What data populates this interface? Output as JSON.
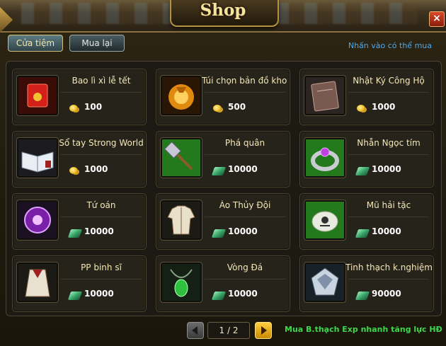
{
  "window": {
    "title": "Shop",
    "close_label": "×"
  },
  "tabs": [
    {
      "label": "Cửa tiệm",
      "active": true
    },
    {
      "label": "Mua lại",
      "active": false
    }
  ],
  "hint": "Nhấn vào có thể mua",
  "items": [
    {
      "name": "Bao lì xì lễ tết",
      "price": "100",
      "currency": "coin-icon",
      "icon": "red-envelope-icon"
    },
    {
      "name": "Túi chọn bản đồ kho báu",
      "price": "500",
      "currency": "coin-icon",
      "icon": "treasure-bag-icon"
    },
    {
      "name": "Nhật Ký Công Hộ",
      "price": "1000",
      "currency": "coin-icon",
      "icon": "journal-book-icon"
    },
    {
      "name": "Sổ tay Strong World",
      "price": "1000",
      "currency": "coin-icon",
      "icon": "open-book-icon"
    },
    {
      "name": "Phá quân",
      "price": "10000",
      "currency": "jade-icon",
      "icon": "hammer-icon"
    },
    {
      "name": "Nhẫn Ngọc tím",
      "price": "10000",
      "currency": "jade-icon",
      "icon": "purple-ring-icon"
    },
    {
      "name": "Tứ oán",
      "price": "10000",
      "currency": "jade-icon",
      "icon": "purple-orb-icon"
    },
    {
      "name": "Áo Thủy Đội",
      "price": "10000",
      "currency": "jade-icon",
      "icon": "navy-coat-icon"
    },
    {
      "name": "Mũ hải tặc",
      "price": "10000",
      "currency": "jade-icon",
      "icon": "pirate-hat-icon"
    },
    {
      "name": "PP binh sĩ",
      "price": "10000",
      "currency": "jade-icon",
      "icon": "soldier-coat-icon"
    },
    {
      "name": "Vòng Đá",
      "price": "10000",
      "currency": "jade-icon",
      "icon": "stone-necklace-icon"
    },
    {
      "name": "Tinh thạch k.nghiệm",
      "price": "90000",
      "currency": "jade-icon",
      "icon": "crystal-icon"
    }
  ],
  "pagination": {
    "text": "1 / 2"
  },
  "promo": "Mua B.thạch Exp nhanh tăng lực HĐ"
}
